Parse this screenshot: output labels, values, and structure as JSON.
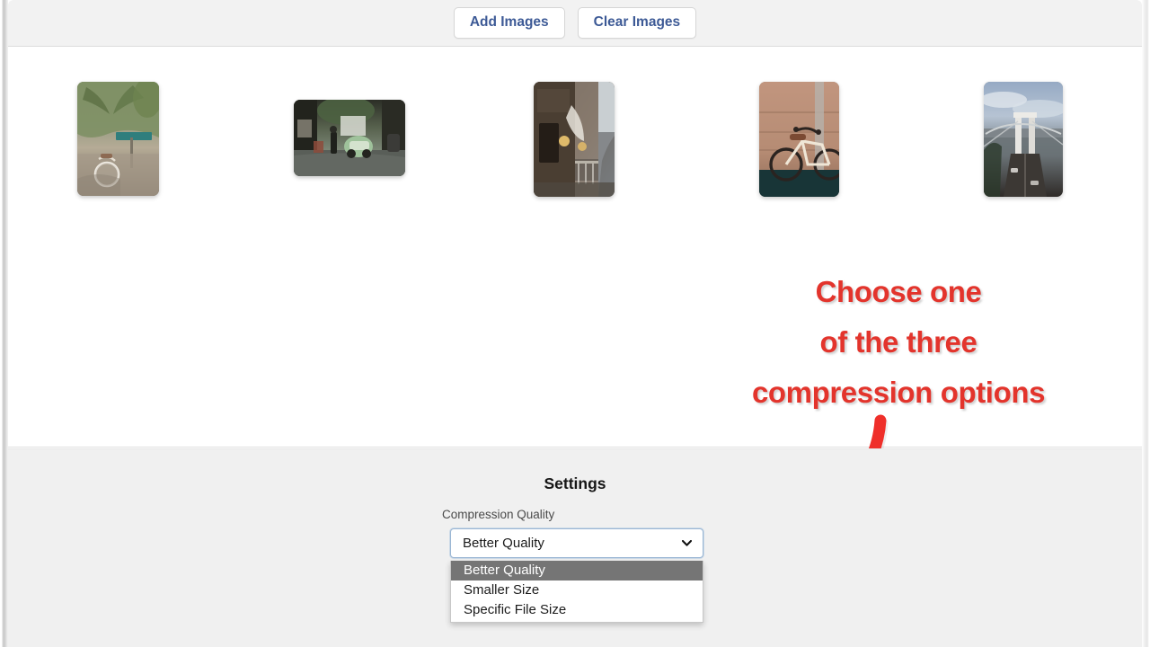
{
  "toolbar": {
    "add_images_label": "Add Images",
    "clear_images_label": "Clear Images"
  },
  "gallery": {
    "thumbnails": [
      {
        "alt": "bicycle under palm trees with street sign",
        "orientation": "portrait"
      },
      {
        "alt": "rainy street with tuk-tuk and shopfronts",
        "orientation": "landscape"
      },
      {
        "alt": "narrow european street with cafe tables",
        "orientation": "portrait"
      },
      {
        "alt": "bicycle leaning against wooden wall",
        "orientation": "portrait"
      },
      {
        "alt": "aerial view of suspension bridge over river",
        "orientation": "portrait"
      }
    ]
  },
  "annotation": {
    "line1": "Choose one",
    "line2": "of the three",
    "line3": "compression options",
    "color": "#e3342c",
    "arrow_color": "#ef2f2a"
  },
  "settings": {
    "title": "Settings",
    "field_label": "Compression Quality",
    "select": {
      "value": "Better Quality",
      "expanded": true,
      "caret_icon": "chevron-down-icon",
      "options": [
        {
          "label": "Better Quality",
          "selected": true
        },
        {
          "label": "Smaller Size",
          "selected": false
        },
        {
          "label": "Specific File Size",
          "selected": false
        }
      ]
    }
  }
}
